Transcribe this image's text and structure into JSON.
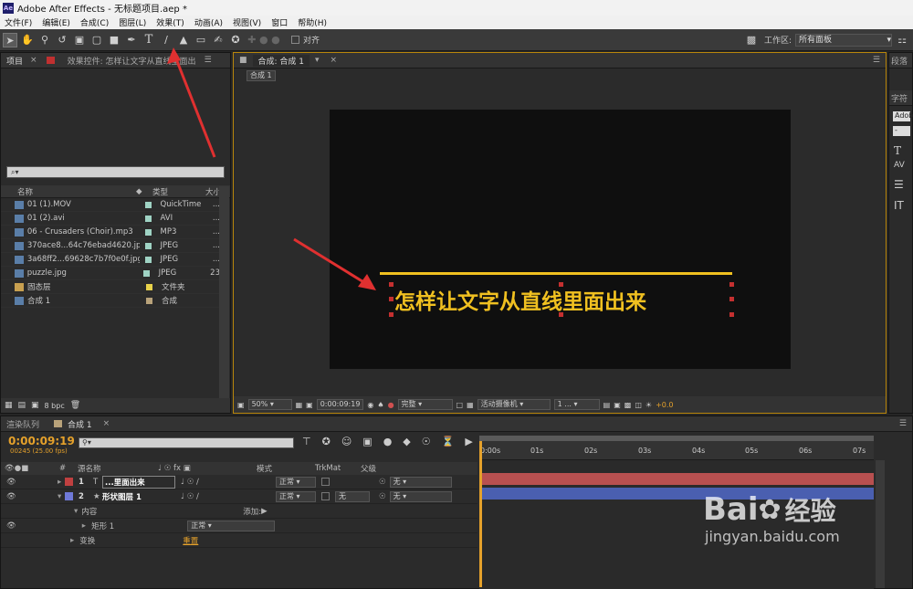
{
  "window": {
    "title": "Adobe After Effects - 无标题项目.aep *",
    "app_logo": "Ae"
  },
  "menu": [
    "文件(F)",
    "编辑(E)",
    "合成(C)",
    "图层(L)",
    "效果(T)",
    "动画(A)",
    "视图(V)",
    "窗口",
    "帮助(H)"
  ],
  "toolbar": {
    "align_label": "对齐",
    "workspace_label": "工作区:",
    "workspace_value": "所有面板"
  },
  "project_panel": {
    "tab_project": "项目",
    "tab_effects": "效果控件: 怎样让文字从直线里面出",
    "search_placeholder": "⌕▾",
    "col_name": "名称",
    "col_type": "类型",
    "col_size": "大小",
    "items": [
      {
        "name": "01 (1).MOV",
        "type": "QuickTime",
        "size": "...",
        "color": "#9fd3c4"
      },
      {
        "name": "01 (2).avi",
        "type": "AVI",
        "size": "...",
        "color": "#9fd3c4"
      },
      {
        "name": "06 - Crusaders (Choir).mp3",
        "type": "MP3",
        "size": "...",
        "color": "#9fd3c4"
      },
      {
        "name": "370ace8...64c76ebad4620.jpg",
        "type": "JPEG",
        "size": "...",
        "color": "#9fd3c4"
      },
      {
        "name": "3a68ff2...69628c7b7f0e0f.jpg",
        "type": "JPEG",
        "size": "...",
        "color": "#9fd3c4"
      },
      {
        "name": "puzzle.jpg",
        "type": "JPEG",
        "size": "23",
        "color": "#9fd3c4"
      },
      {
        "name": "固态层",
        "type": "文件夹",
        "size": "",
        "color": "#e8d24a"
      },
      {
        "name": "合成 1",
        "type": "合成",
        "size": "",
        "color": "#b8a27a"
      }
    ],
    "bpc": "8 bpc"
  },
  "comp_panel": {
    "tab": "合成: 合成 1",
    "breadcrumb": "合成 1",
    "text": "怎样让文字从直线里面出来",
    "zoom": "50%",
    "timecode": "0:00:09:19",
    "quality": "完整",
    "camera": "活动摄像机",
    "views": "1 ...",
    "exposure": "+0.0"
  },
  "right_panel": {
    "tab_top": "段落",
    "tab_char": "字符",
    "font": "Adob"
  },
  "timeline": {
    "tab_render": "渲染队列",
    "tab_comp": "合成 1",
    "timecode": "0:00:09:19",
    "frames": "00245 (25.00 fps)",
    "col_source": "源名称",
    "col_mode": "模式",
    "col_trkmat": "TrkMat",
    "col_parent": "父级",
    "layers": [
      {
        "num": "1",
        "name": "...里面出来",
        "mode": "正常",
        "trkmat": "",
        "parent": "无",
        "color": "#c04040",
        "bar": "#b85050"
      },
      {
        "num": "2",
        "name": "形状图层 1",
        "mode": "正常",
        "trkmat": "无",
        "parent": "无",
        "color": "#6f79d8",
        "bar": "#4a5fb0"
      }
    ],
    "content_label": "内容",
    "add_label": "添加:",
    "rect_label": "矩形 1",
    "rect_mode": "正常",
    "transform_label": "变换",
    "reset_label": "重置",
    "ruler": [
      "0:00s",
      "01s",
      "02s",
      "03s",
      "04s",
      "05s",
      "06s",
      "07s"
    ]
  },
  "watermark": {
    "brand": "Bai",
    "brand2": "经验",
    "url": "jingyan.baidu.com"
  },
  "colors": {
    "accent_yellow": "#f0c020",
    "highlight_orange": "#e5a12b",
    "arrow_red": "#e03030"
  }
}
